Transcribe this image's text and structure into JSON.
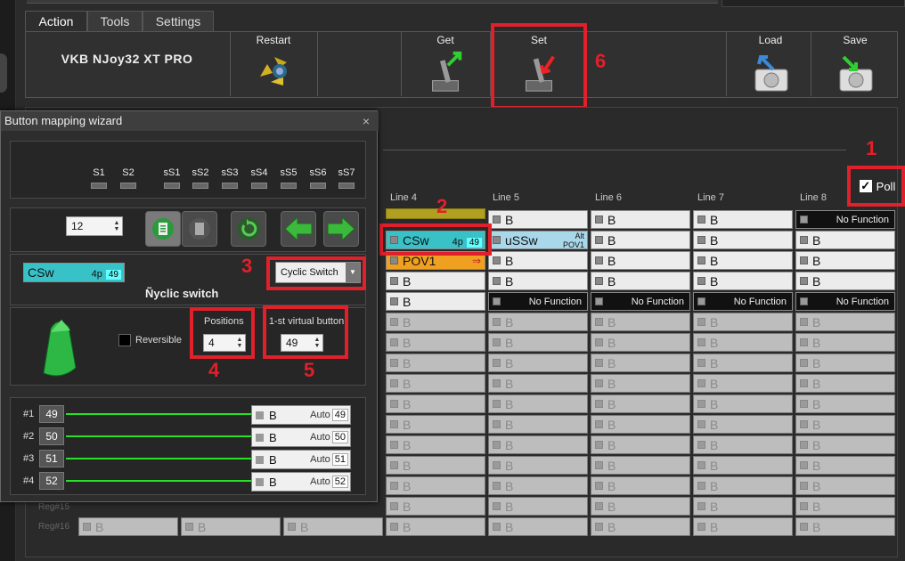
{
  "tabs": [
    {
      "label": "Action"
    },
    {
      "label": "Tools"
    },
    {
      "label": "Settings"
    }
  ],
  "toolbar": {
    "device_name": "VKB NJoy32 XT PRO",
    "restart": "Restart",
    "get": "Get",
    "set": "Set",
    "load": "Load",
    "save": "Save"
  },
  "poll": {
    "label": "Poll",
    "checked": true
  },
  "callouts": [
    "1",
    "2",
    "3",
    "4",
    "5",
    "6"
  ],
  "line_headers": [
    "Line 4",
    "Line 5",
    "Line 6",
    "Line 7",
    "Line 8"
  ],
  "rows_upper": [
    [
      {
        "t": "gold",
        "v": ""
      },
      {
        "t": "b",
        "v": "B"
      },
      {
        "t": "b",
        "v": "B"
      },
      {
        "t": "b",
        "v": "B"
      },
      {
        "t": "nf",
        "v": "No Function"
      }
    ],
    [
      {
        "t": "csw",
        "v": "CSw",
        "p": "4p",
        "n": "49"
      },
      {
        "t": "ussw",
        "v": "uSSw",
        "alt": "Alt",
        "pov": "POV1"
      },
      {
        "t": "b",
        "v": "B"
      },
      {
        "t": "b",
        "v": "B"
      },
      {
        "t": "b",
        "v": "B"
      }
    ],
    [
      {
        "t": "pov",
        "v": "POV1"
      },
      {
        "t": "b",
        "v": "B"
      },
      {
        "t": "b",
        "v": "B"
      },
      {
        "t": "b",
        "v": "B"
      },
      {
        "t": "b",
        "v": "B"
      }
    ],
    [
      {
        "t": "b",
        "v": "B"
      },
      {
        "t": "b",
        "v": "B"
      },
      {
        "t": "b",
        "v": "B"
      },
      {
        "t": "b",
        "v": "B"
      },
      {
        "t": "b",
        "v": "B"
      }
    ],
    [
      {
        "t": "b",
        "v": "B"
      },
      {
        "t": "nf",
        "v": "No Function"
      },
      {
        "t": "nf",
        "v": "No Function"
      },
      {
        "t": "nf",
        "v": "No Function"
      },
      {
        "t": "nf",
        "v": "No Function"
      }
    ]
  ],
  "disabled_cell": "B",
  "reg_labels": [
    "Reg#15",
    "Reg#16"
  ],
  "wizard": {
    "title": "Button mapping wizard",
    "close": "×",
    "s_labels": [
      "S1",
      "S2",
      "sS1",
      "sS2",
      "sS3",
      "sS4",
      "sS5",
      "sS6",
      "sS7"
    ],
    "spin_value": "12",
    "mode_cell": {
      "v": "CSw",
      "p": "4p",
      "n": "49"
    },
    "mode_name": "Ñyclic switch",
    "mode_dropdown": "Cyclic Switch",
    "reversible": "Reversible",
    "positions_label": "Positions",
    "positions_value": "4",
    "first_vb_label": "1-st virtual button",
    "first_vb_value": "49",
    "mappings": [
      {
        "idx": "#1",
        "val": "49",
        "b": "B",
        "auto": "Auto",
        "n": "49"
      },
      {
        "idx": "#2",
        "val": "50",
        "b": "B",
        "auto": "Auto",
        "n": "50"
      },
      {
        "idx": "#3",
        "val": "51",
        "b": "B",
        "auto": "Auto",
        "n": "51"
      },
      {
        "idx": "#4",
        "val": "52",
        "b": "B",
        "auto": "Auto",
        "n": "52"
      }
    ]
  },
  "colors": {
    "accent_red": "#e0202a",
    "csw": "#38c2c8",
    "pov": "#f0a020",
    "green": "#28e028"
  }
}
